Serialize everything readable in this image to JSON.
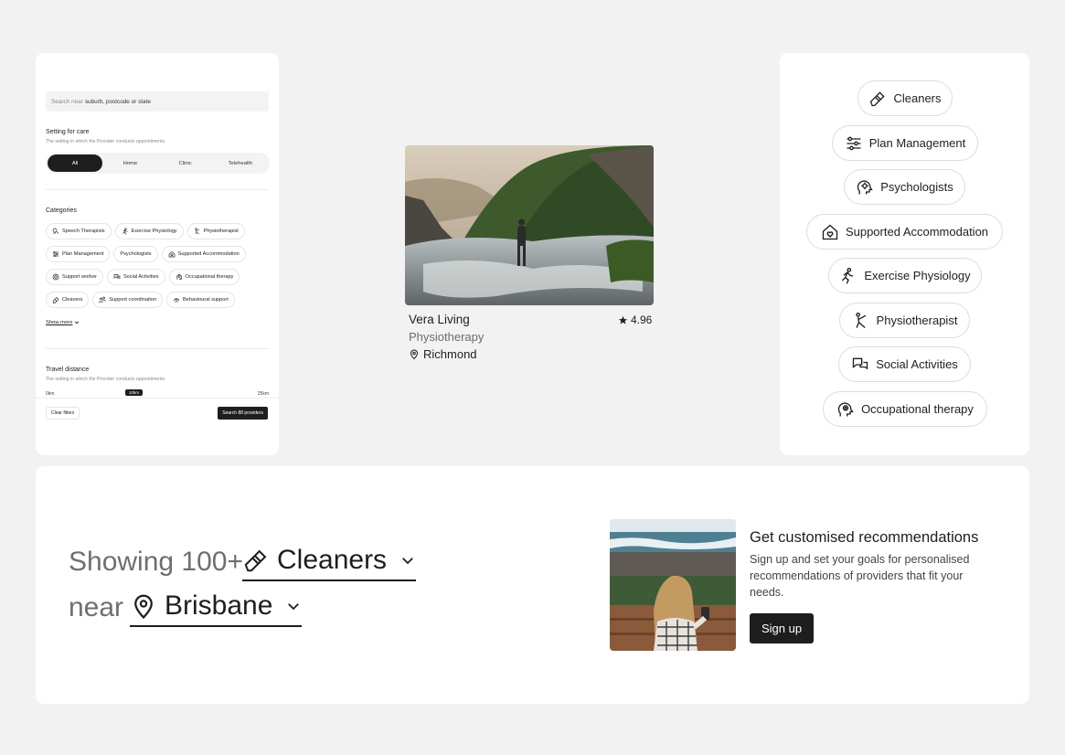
{
  "filters": {
    "search_placeholder": "Search near",
    "search_hint": "suburb, postcode or state",
    "setting_title": "Setting for care",
    "setting_subtitle": "The setting in which the Provider conducts appointments",
    "setting_options": [
      "All",
      "Home",
      "Clinic",
      "Telehealth"
    ],
    "setting_selected": "All",
    "categories_title": "Categories",
    "categories": [
      [
        "Speech Therapists",
        "Exercise Physiology",
        "Physiotherapist"
      ],
      [
        "Plan Management",
        "Psychologists",
        "Supported Accommodation"
      ],
      [
        "Support worker",
        "Social Activities",
        "Occupational therapy"
      ],
      [
        "Cleaners",
        "Support coordination",
        "Behavioural support"
      ]
    ],
    "show_more": "Show more",
    "distance_title": "Travel distance",
    "distance_subtitle": "The setting in which the Provider conducts appointments",
    "distance_min": "0km",
    "distance_current": "10km",
    "distance_max": "25km",
    "clear_label": "Clear filters",
    "search_label": "Search 88 providers"
  },
  "provider": {
    "name": "Vera Living",
    "rating": "4.96",
    "type": "Physiotherapy",
    "location": "Richmond"
  },
  "category_pills": [
    {
      "label": "Cleaners",
      "icon": "eraser-icon"
    },
    {
      "label": "Plan Management",
      "icon": "sliders-icon"
    },
    {
      "label": "Psychologists",
      "icon": "head-gear-icon"
    },
    {
      "label": "Supported Accommodation",
      "icon": "house-heart-icon"
    },
    {
      "label": "Exercise Physiology",
      "icon": "running-person-icon"
    },
    {
      "label": "Physiotherapist",
      "icon": "stretching-person-icon"
    },
    {
      "label": "Social Activities",
      "icon": "chat-bubbles-icon"
    },
    {
      "label": "Occupational therapy",
      "icon": "head-brain-icon"
    }
  ],
  "results": {
    "showing_prefix": "Showing 100+",
    "category_value": "Cleaners",
    "near_label": "near",
    "location_value": "Brisbane"
  },
  "promo": {
    "title": "Get customised recommendations",
    "body": "Sign up and set your goals for personalised recommendations of providers that fit your needs.",
    "button_label": "Sign up"
  },
  "colors": {
    "background": "#f2f2f2",
    "card": "#ffffff",
    "primary": "#1e1e1e",
    "muted_text": "#6f6f6f",
    "pill_border": "#dcdcdc"
  }
}
